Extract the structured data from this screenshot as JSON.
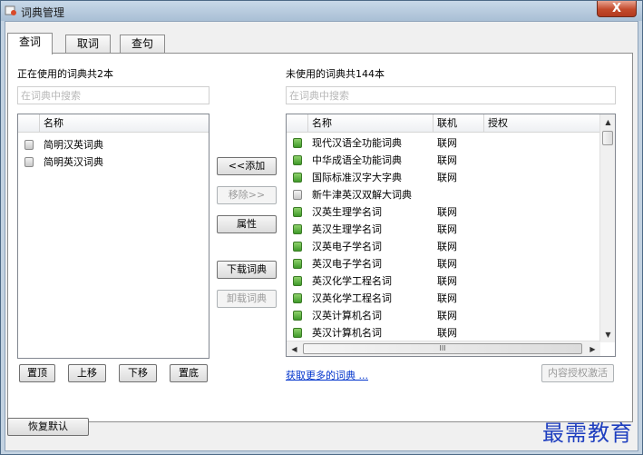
{
  "window": {
    "title": "词典管理",
    "close_label": "X"
  },
  "tabs": [
    {
      "label": "查词",
      "active": true
    },
    {
      "label": "取词",
      "active": false
    },
    {
      "label": "查句",
      "active": false
    }
  ],
  "left": {
    "heading": "正在使用的词典共2本",
    "search_placeholder": "在词典中搜索",
    "column_name": "名称",
    "items": [
      {
        "name": "简明汉英词典",
        "icon": "dictionary-gray-icon"
      },
      {
        "name": "简明英汉词典",
        "icon": "dictionary-gray-icon"
      }
    ],
    "buttons": {
      "top": "置顶",
      "up": "上移",
      "down": "下移",
      "bottom": "置底"
    }
  },
  "middle": {
    "add": "<<添加",
    "remove": "移除>>",
    "properties": "属性",
    "download": "下载词典",
    "uninstall": "卸载词典"
  },
  "right": {
    "heading": "未使用的词典共144本",
    "search_placeholder": "在词典中搜索",
    "columns": {
      "name": "名称",
      "online": "联机",
      "license": "授权"
    },
    "items": [
      {
        "name": "现代汉语全功能词典",
        "online": "联网",
        "icon": "dictionary-green-icon"
      },
      {
        "name": "中华成语全功能词典",
        "online": "联网",
        "icon": "dictionary-green-icon"
      },
      {
        "name": "国际标准汉字大字典",
        "online": "联网",
        "icon": "dictionary-green-icon"
      },
      {
        "name": "新牛津英汉双解大词典",
        "online": "",
        "icon": "dictionary-gray-icon"
      },
      {
        "name": "汉英生理学名词",
        "online": "联网",
        "icon": "dictionary-green-icon"
      },
      {
        "name": "英汉生理学名词",
        "online": "联网",
        "icon": "dictionary-green-icon"
      },
      {
        "name": "汉英电子学名词",
        "online": "联网",
        "icon": "dictionary-green-icon"
      },
      {
        "name": "英汉电子学名词",
        "online": "联网",
        "icon": "dictionary-green-icon"
      },
      {
        "name": "英汉化学工程名词",
        "online": "联网",
        "icon": "dictionary-green-icon"
      },
      {
        "name": "汉英化学工程名词",
        "online": "联网",
        "icon": "dictionary-green-icon"
      },
      {
        "name": "汉英计算机名词",
        "online": "联网",
        "icon": "dictionary-green-icon"
      },
      {
        "name": "英汉计算机名词",
        "online": "联网",
        "icon": "dictionary-green-icon"
      }
    ],
    "hscroll_grip": "III",
    "more_link": "获取更多的词典 ...",
    "license_button": "内容授权激活"
  },
  "footer": {
    "restore_default": "恢复默认"
  },
  "watermark": "最需教育"
}
